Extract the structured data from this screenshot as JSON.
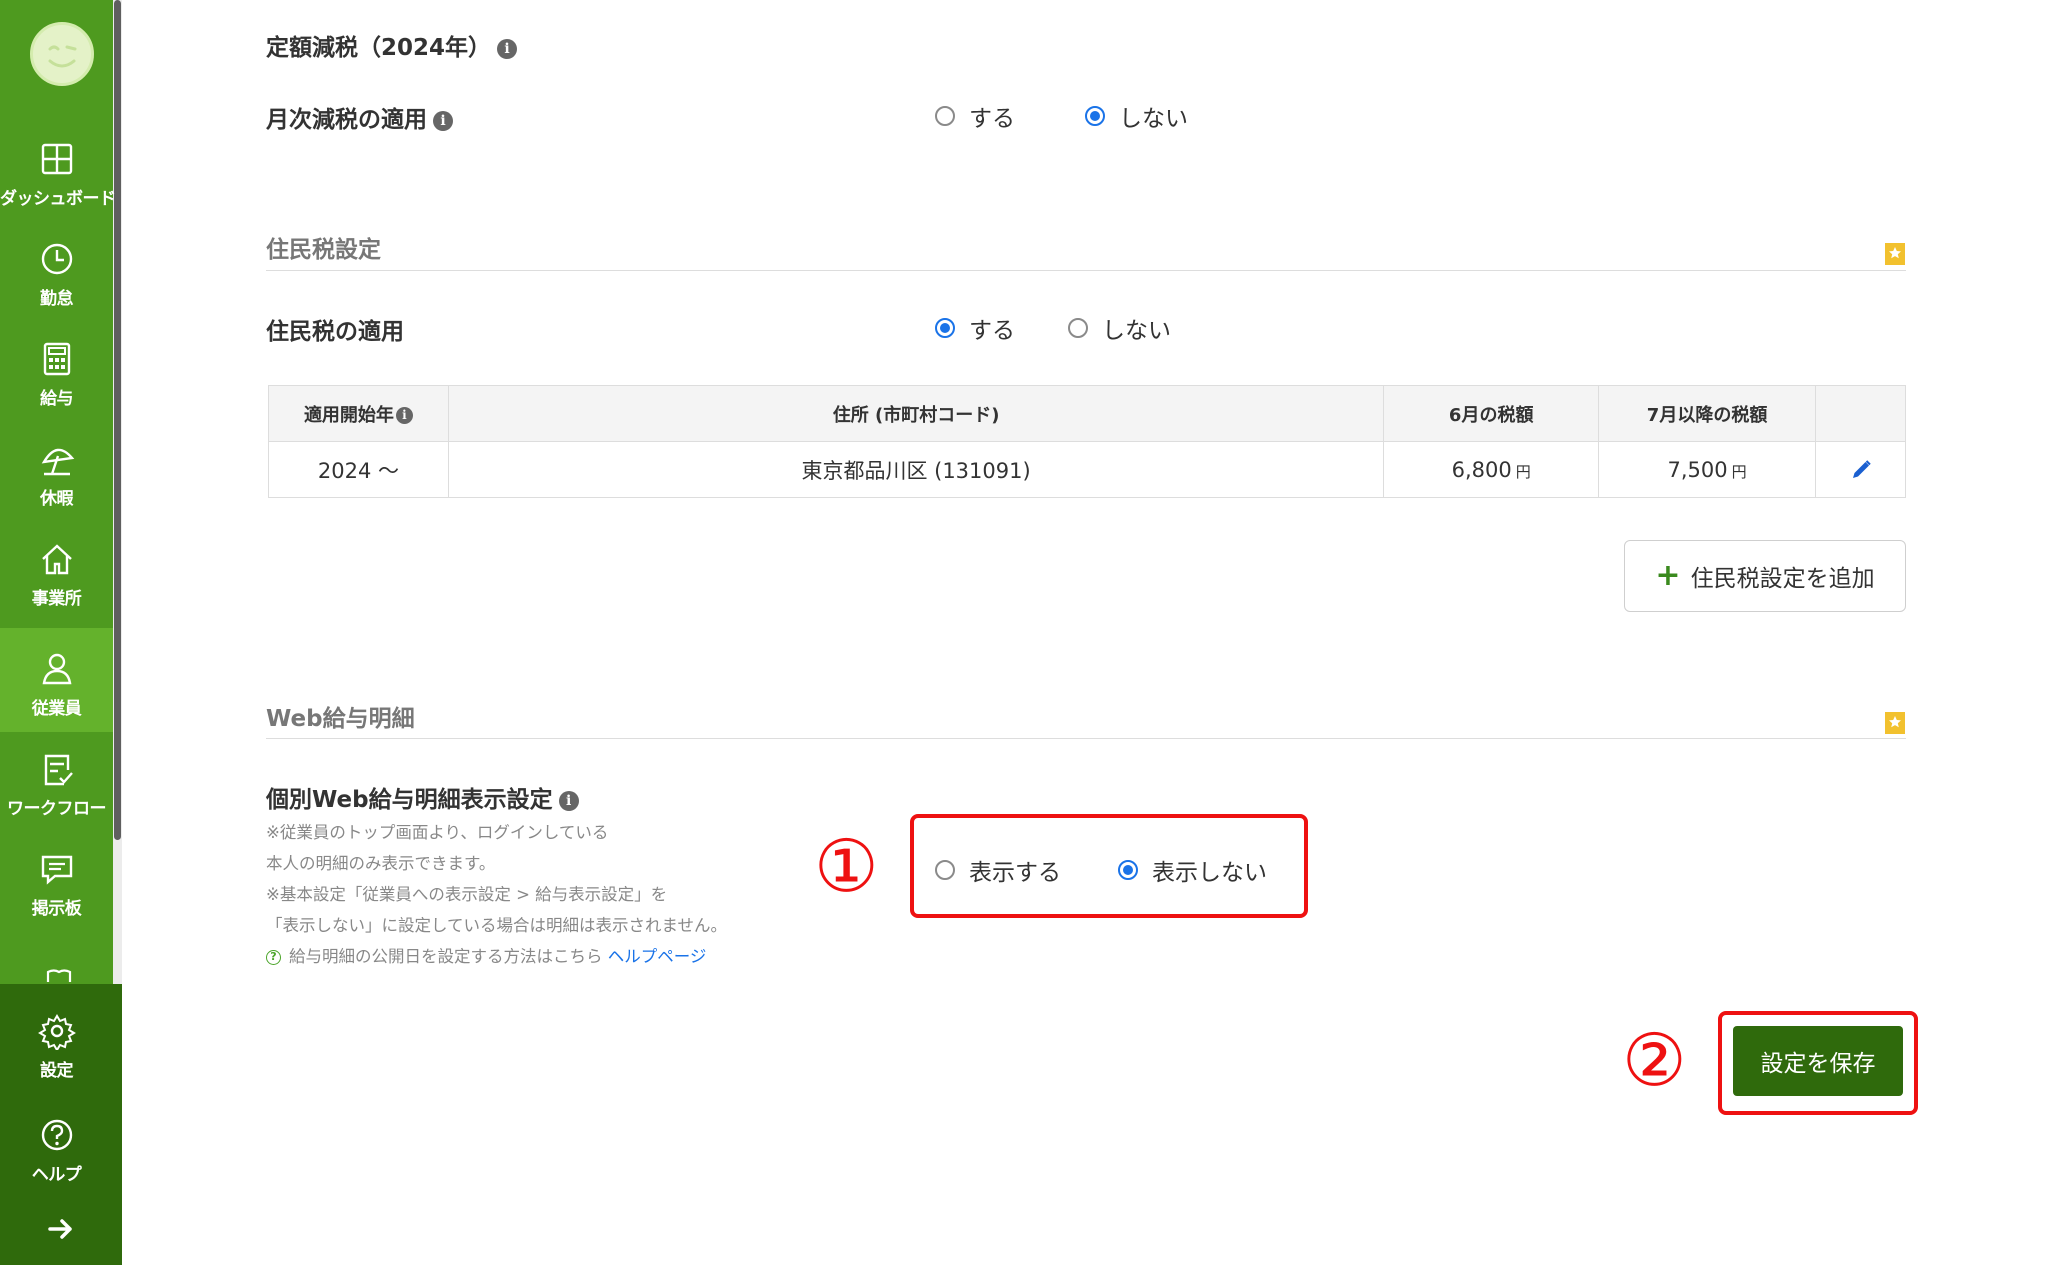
{
  "sidebar": {
    "items": [
      {
        "label": "ダッシュボード",
        "icon": "dashboard-icon"
      },
      {
        "label": "勤怠",
        "icon": "clock-icon"
      },
      {
        "label": "給与",
        "icon": "calculator-icon"
      },
      {
        "label": "休暇",
        "icon": "umbrella-icon"
      },
      {
        "label": "事業所",
        "icon": "home-icon"
      },
      {
        "label": "従業員",
        "icon": "person-icon",
        "active": true
      },
      {
        "label": "ワークフロー",
        "icon": "checklist-icon"
      },
      {
        "label": "掲示板",
        "icon": "chat-icon"
      }
    ],
    "bottom_items": [
      {
        "label": "設定",
        "icon": "gear-icon"
      },
      {
        "label": "ヘルプ",
        "icon": "question-icon"
      }
    ]
  },
  "fixed_tax": {
    "title": "定額減税（2024年）",
    "monthly_label": "月次減税の適用",
    "options": [
      "する",
      "しない"
    ],
    "selected": "しない"
  },
  "resident_tax": {
    "section_title": "住民税設定",
    "apply_label": "住民税の適用",
    "options": [
      "する",
      "しない"
    ],
    "selected": "する",
    "table": {
      "headers": [
        "適用開始年",
        "住所 (市町村コード)",
        "6月の税額",
        "7月以降の税額"
      ],
      "rows": [
        {
          "start_year": "2024 ～",
          "address": "東京都品川区 (131091)",
          "june_tax": "6,800",
          "july_tax": "7,500",
          "unit": "円"
        }
      ]
    },
    "add_button": "住民税設定を追加"
  },
  "web_payslip": {
    "section_title": "Web給与明細",
    "setting_label": "個別Web給与明細表示設定",
    "notes": [
      "※従業員のトップ画面より、ログインしている",
      "本人の明細のみ表示できます。",
      "※基本設定「従業員への表示設定 > 給与表示設定」を",
      "「表示しない」に設定している場合は明細は表示されません。"
    ],
    "help_text": "給与明細の公開日を設定する方法はこちら",
    "help_link": "ヘルプページ",
    "options": [
      "表示する",
      "表示しない"
    ],
    "selected": "表示しない"
  },
  "annotations": {
    "step1": "①",
    "step2": "②"
  },
  "save_button": "設定を保存",
  "colors": {
    "sidebar": "#4e9a1f",
    "sidebar_dark": "#2f6a0c",
    "active": "#64b22c",
    "accent": "#1a73e8",
    "highlight": "#ee1111"
  }
}
